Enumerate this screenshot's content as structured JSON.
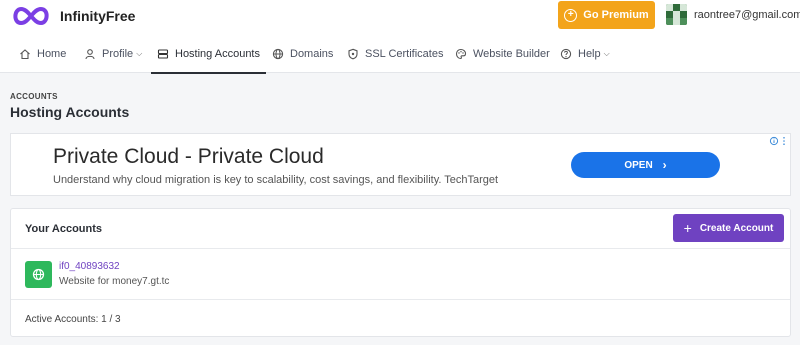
{
  "brand": {
    "name": "InfinityFree",
    "accent": "#7b3fe4"
  },
  "header": {
    "premium_label": "Go Premium",
    "premium_color": "#f3a41b",
    "user_email": "raontree7@gmail.com"
  },
  "nav": {
    "items": [
      {
        "label": "Home",
        "icon": "home-icon"
      },
      {
        "label": "Profile",
        "icon": "user-icon",
        "dropdown": true
      },
      {
        "label": "Hosting Accounts",
        "icon": "server-icon",
        "active": true
      },
      {
        "label": "Domains",
        "icon": "globe-icon"
      },
      {
        "label": "SSL Certificates",
        "icon": "shield-icon"
      },
      {
        "label": "Website Builder",
        "icon": "palette-icon"
      },
      {
        "label": "Help",
        "icon": "question-icon",
        "dropdown": true
      }
    ]
  },
  "page": {
    "breadcrumb": "ACCOUNTS",
    "title": "Hosting Accounts"
  },
  "ad": {
    "headline": "Private Cloud - Private Cloud",
    "description": "Understand why cloud migration is key to scalability, cost savings, and flexibility. TechTarget",
    "cta": "OPEN",
    "cta_color": "#1a73e8"
  },
  "accounts": {
    "title": "Your Accounts",
    "create_label": "Create Account",
    "create_color": "#6f42c1",
    "rows": [
      {
        "username": "if0_40893632",
        "label": "Website for money7.gt.tc"
      }
    ],
    "footer": "Active Accounts: 1 / 3"
  }
}
